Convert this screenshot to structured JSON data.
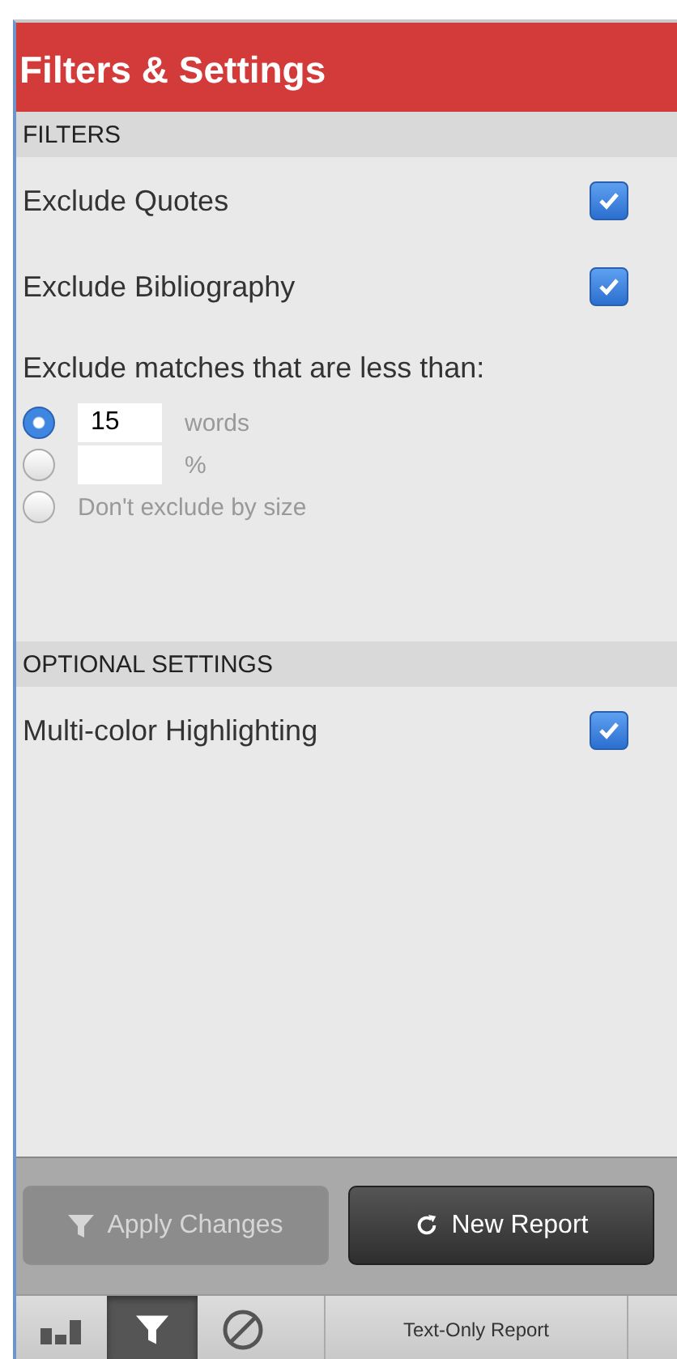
{
  "title": "Filters & Settings",
  "sections": [
    {
      "heading": "FILTERS",
      "options": [
        {
          "label": "Exclude Quotes",
          "checked": true
        },
        {
          "label": "Exclude Bibliography",
          "checked": true
        }
      ],
      "size_filter": {
        "label": "Exclude matches that are less than:",
        "choices": [
          {
            "kind": "input",
            "value": "15",
            "unit": "words",
            "selected": true
          },
          {
            "kind": "input",
            "unit": "%",
            "selected": false
          },
          {
            "kind": "text",
            "label": "Don't exclude by size",
            "selected": false
          }
        ]
      }
    },
    {
      "heading": "OPTIONAL SETTINGS",
      "options": [
        {
          "label": "Multi-color Highlighting",
          "checked": true
        }
      ]
    }
  ],
  "buttons": [
    {
      "kind": "filter",
      "label": "Apply Changes",
      "disabled": true
    },
    {
      "kind": "refresh",
      "label": "New Report",
      "disabled": false
    }
  ],
  "toolbar": [
    {
      "kind": "bars",
      "selected": false
    },
    {
      "kind": "filter",
      "selected": true
    },
    {
      "kind": "block",
      "selected": false
    },
    {
      "kind": "text",
      "label": "Text-Only Report"
    }
  ]
}
